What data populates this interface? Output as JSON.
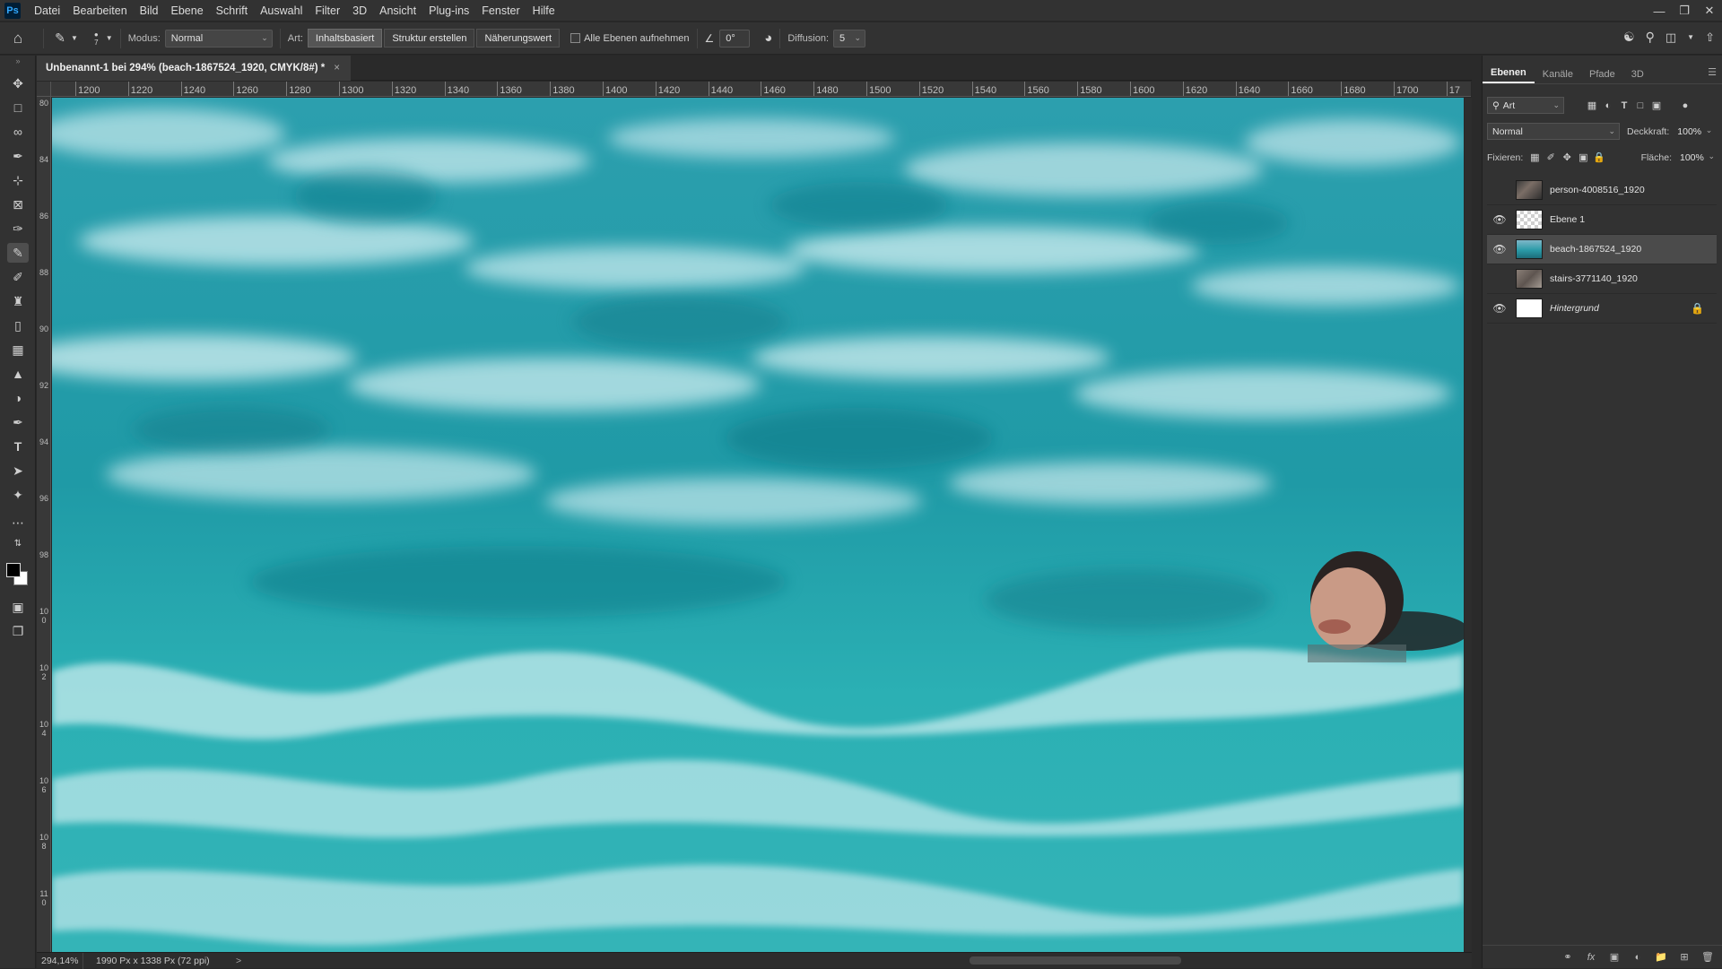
{
  "app": {
    "logo": "Ps"
  },
  "menu": [
    "Datei",
    "Bearbeiten",
    "Bild",
    "Ebene",
    "Schrift",
    "Auswahl",
    "Filter",
    "3D",
    "Ansicht",
    "Plug-ins",
    "Fenster",
    "Hilfe"
  ],
  "options": {
    "brush_size": "7",
    "mode_label": "Modus:",
    "mode_value": "Normal",
    "type_label": "Art:",
    "type_content_aware": "Inhaltsbasiert",
    "type_create_texture": "Struktur erstellen",
    "type_proximity_match": "Näherungswert",
    "sample_all_layers": "Alle Ebenen aufnehmen",
    "angle_value": "0°",
    "diffusion_label": "Diffusion:",
    "diffusion_value": "5"
  },
  "document": {
    "tab_title": "Unbenannt-1 bei 294% (beach-1867524_1920, CMYK/8#) *",
    "close_glyph": "×"
  },
  "ruler": {
    "horizontal": [
      "1200",
      "1220",
      "1240",
      "1260",
      "1280",
      "1300",
      "1320",
      "1340",
      "1360",
      "1380",
      "1400",
      "1420",
      "1440",
      "1460",
      "1480",
      "1500",
      "1520",
      "1540",
      "1560",
      "1580",
      "1600",
      "1620",
      "1640",
      "1660",
      "1680",
      "1700",
      "17"
    ],
    "vertical": [
      "80",
      "84",
      "86",
      "88",
      "90",
      "92",
      "94",
      "96",
      "98",
      "100",
      "102",
      "104",
      "106",
      "108",
      "110"
    ]
  },
  "status": {
    "zoom": "294,14%",
    "doc_info": "1990 Px x 1338 Px (72 ppi)",
    "arrow": ">"
  },
  "panel": {
    "tabs": [
      "Ebenen",
      "Kanäle",
      "Pfade",
      "3D"
    ],
    "filter_kind": "Art",
    "blend_mode": "Normal",
    "opacity_label": "Deckkraft:",
    "opacity_value": "100%",
    "lock_label": "Fixieren:",
    "fill_label": "Fläche:",
    "fill_value": "100%",
    "layers": [
      {
        "name": "person-4008516_1920",
        "visible": false
      },
      {
        "name": "Ebene 1",
        "visible": true
      },
      {
        "name": "beach-1867524_1920",
        "visible": true,
        "selected": true
      },
      {
        "name": "stairs-3771140_1920",
        "visible": false
      },
      {
        "name": "Hintergrund",
        "visible": true,
        "locked": true
      }
    ]
  },
  "colors": {
    "water": "#27a3ac",
    "ui_bg": "#323232",
    "selected_layer": "#4b4b4b"
  }
}
